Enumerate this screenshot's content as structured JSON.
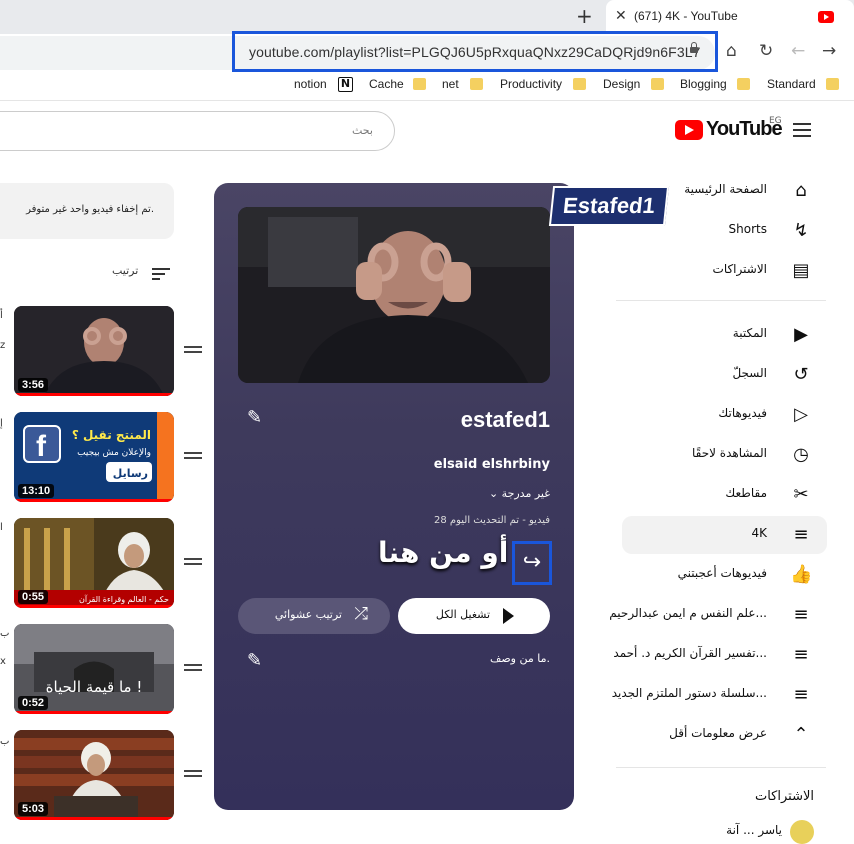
{
  "browser": {
    "tab_title": "(671) 4K - YouTube",
    "url": "youtube.com/playlist?list=PLGQJ6U5pRxquaQNxz29CaDQRjd9n6F3L7",
    "bookmarks": [
      "notion",
      "Cache",
      "net",
      "Productivity",
      "Design",
      "Blogging",
      "Standard"
    ]
  },
  "header": {
    "search_placeholder": "بحث",
    "logo_text": "YouTube",
    "country_code": "EG"
  },
  "sidebar": {
    "top": [
      {
        "label": "الصفحة الرئيسية",
        "icon": "home-icon"
      },
      {
        "label": "Shorts",
        "icon": "shorts-icon"
      },
      {
        "label": "الاشتراكات",
        "icon": "subscriptions-icon"
      }
    ],
    "library": [
      {
        "label": "المكتبة",
        "icon": "library-icon"
      },
      {
        "label": "السجلّ",
        "icon": "history-icon"
      },
      {
        "label": "فيديوهاتك",
        "icon": "your-videos-icon"
      },
      {
        "label": "المشاهدة لاحقًا",
        "icon": "watch-later-icon"
      },
      {
        "label": "مقاطعك",
        "icon": "clips-icon"
      },
      {
        "label": "4K",
        "icon": "playlist-icon",
        "active": true
      },
      {
        "label": "فيديوهات أعجبتني",
        "icon": "like-icon"
      },
      {
        "label": "علم النفس م ايمن عبدالرحيم...",
        "icon": "playlist-icon"
      },
      {
        "label": "تفسير القرآن الكريم د. أحمد...",
        "icon": "playlist-icon"
      },
      {
        "label": "سلسلة دستور الملتزم الجديد...",
        "icon": "playlist-icon"
      },
      {
        "label": "عرض معلومات أقل",
        "icon": "chevron-up-icon"
      }
    ],
    "subscriptions_title": "الاشتراكات",
    "first_channel": "ياسر ... آنة"
  },
  "playlist": {
    "title": "estafed1",
    "owner": "elsaid elshrbiny",
    "privacy": "غير مدرجة",
    "meta": "28 فيديو - تم التحديث اليوم",
    "overlay_text": "أو من هنا",
    "play_all": "تشغيل الكل",
    "shuffle": "ترتيب عشوائي",
    "description": "ما من وصف."
  },
  "watermark": "Estafed1",
  "notice": "تم إخفاء فيديو واحد غير متوفر.",
  "sort_label": "ترتيب",
  "videos": [
    {
      "duration": "3:56",
      "edge": "أ",
      "edge2": "z",
      "progress": 1.0
    },
    {
      "duration": "13:10",
      "edge": "إ",
      "progress": 1.0,
      "thumb_text_1": "المنتج تقيل ؟",
      "thumb_text_2": "والإعلان مش بيجيب",
      "thumb_text_3": "رسايل"
    },
    {
      "duration": "0:55",
      "edge": "ا",
      "progress": 1.0,
      "thumb_caption": "حكم - العالم وقراءة القرآن"
    },
    {
      "duration": "0:52",
      "edge": "ب",
      "edge2": "x",
      "progress": 1.0,
      "thumb_text": "ما قيمة الحياة !"
    },
    {
      "duration": "5:03",
      "edge": "ب",
      "progress": 1.0
    }
  ]
}
